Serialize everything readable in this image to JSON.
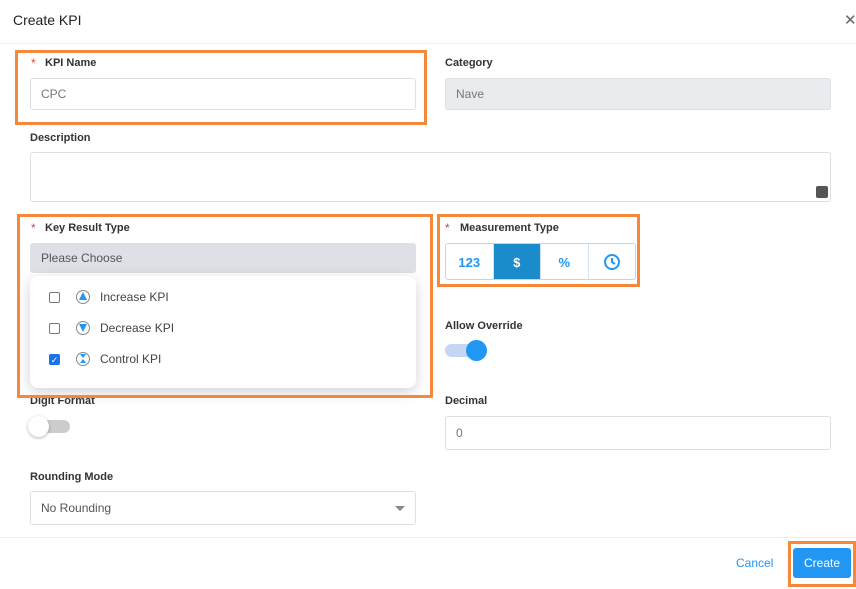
{
  "dialog": {
    "title": "Create KPI",
    "close_icon": "close-icon"
  },
  "kpi_name": {
    "label": "KPI Name",
    "required_mark": "*",
    "value": "CPC"
  },
  "category": {
    "label": "Category",
    "value": "Nave"
  },
  "description": {
    "label": "Description",
    "value": ""
  },
  "key_result_type": {
    "label": "Key Result Type",
    "required_mark": "*",
    "placeholder": "Please Choose",
    "options": [
      {
        "label": "Increase KPI",
        "checked": false,
        "icon": "arrow-up-circle-icon"
      },
      {
        "label": "Decrease KPI",
        "checked": false,
        "icon": "arrow-down-circle-icon"
      },
      {
        "label": "Control KPI",
        "checked": true,
        "icon": "control-circle-icon"
      }
    ]
  },
  "measurement_type": {
    "label": "Measurement Type",
    "required_mark": "*",
    "options": [
      "123",
      "$",
      "%",
      "clock"
    ],
    "selected": "$"
  },
  "allow_override": {
    "label": "Allow Override",
    "on": true
  },
  "digit_format": {
    "label": "Digit Format",
    "on": false
  },
  "decimal": {
    "label": "Decimal",
    "value": "0"
  },
  "rounding_mode": {
    "label": "Rounding Mode",
    "value": "No Rounding"
  },
  "footer": {
    "cancel": "Cancel",
    "create": "Create"
  },
  "colors": {
    "accent": "#2196f3",
    "active_segment": "#1a8ccc",
    "highlight": "#f5883a"
  }
}
